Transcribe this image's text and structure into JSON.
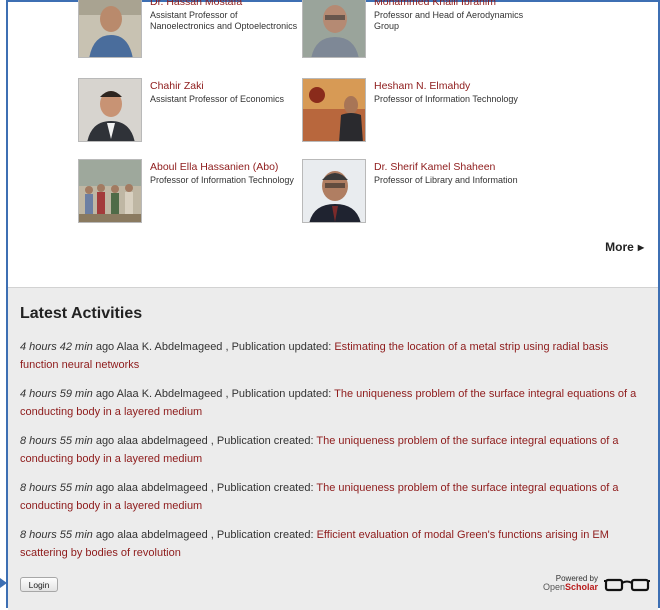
{
  "people": [
    {
      "name": "Dr. Hassan Mostafa",
      "title": "Assistant Professor of Nanoelectronics and Optoelectronics",
      "photo_icon": "portrait-photo"
    },
    {
      "name": "Mohammed Khalil Ibrahim",
      "title": "Professor and Head of Aerodynamics Group",
      "photo_icon": "portrait-photo"
    },
    {
      "name": "Chahir Zaki",
      "title": "Assistant Professor of Economics",
      "photo_icon": "portrait-photo"
    },
    {
      "name": "Hesham N. Elmahdy",
      "title": "Professor of Information Technology",
      "photo_icon": "portrait-photo"
    },
    {
      "name": "Aboul Ella Hassanien (Abo)",
      "title": "Professor of Information Technology",
      "photo_icon": "group-photo"
    },
    {
      "name": "Dr. Sherif Kamel Shaheen",
      "title": "Professor of Library and Information",
      "photo_icon": "portrait-photo"
    }
  ],
  "more_label": "More",
  "activities": {
    "title": "Latest Activities",
    "items": [
      {
        "time": "4 hours 42 min",
        "rest": " ago Alaa K. Abdelmageed , Publication updated: ",
        "link": "Estimating the location of a metal strip using radial basis function neural networks"
      },
      {
        "time": "4 hours 59 min",
        "rest": " ago Alaa K. Abdelmageed , Publication updated: ",
        "link": "The uniqueness problem of the surface integral equations of a conducting body in a layered medium"
      },
      {
        "time": "8 hours 55 min",
        "rest": " ago alaa abdelmageed , Publication created: ",
        "link": "The uniqueness problem of the surface integral equations of a conducting body in a layered medium"
      },
      {
        "time": "8 hours 55 min",
        "rest": " ago alaa abdelmageed , Publication created: ",
        "link": "The uniqueness problem of the surface integral equations of a conducting body in a layered medium"
      },
      {
        "time": "8 hours 55 min",
        "rest": " ago alaa abdelmageed , Publication created: ",
        "link": "Efficient evaluation of modal Green's functions arising in EM scattering by bodies of revolution"
      }
    ]
  },
  "login_label": "Login",
  "powered": {
    "line1": "Powered by",
    "brand_open": "Open",
    "brand_scholar": "Scholar"
  },
  "colors": {
    "link": "#8e1b1b",
    "frame": "#3d6fb3",
    "panel": "#ececec"
  }
}
